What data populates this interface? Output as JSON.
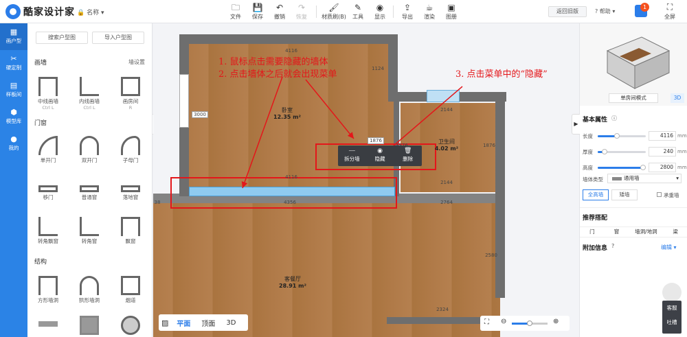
{
  "app": {
    "logo_text": "酷家设计家",
    "project_name": "名称"
  },
  "toolbar": {
    "items": [
      {
        "label": "文件",
        "icon": "file-icon"
      },
      {
        "label": "保存",
        "icon": "save-icon"
      },
      {
        "label": "撤销",
        "icon": "undo-icon"
      },
      {
        "label": "恢复",
        "icon": "redo-icon"
      },
      {
        "label": "材质刷(B)",
        "icon": "brush-icon"
      },
      {
        "label": "工具",
        "icon": "tool-icon"
      },
      {
        "label": "显示",
        "icon": "eye-icon"
      },
      {
        "label": "导出",
        "icon": "export-icon"
      },
      {
        "label": "渲染",
        "icon": "render-icon"
      },
      {
        "label": "图册",
        "icon": "album-icon"
      }
    ],
    "back_old": "返回旧版",
    "help": "帮助",
    "badge": "1",
    "fullscreen": "全屏"
  },
  "leftnav": [
    {
      "label": "画户型"
    },
    {
      "label": "硬定制"
    },
    {
      "label": "样板间"
    },
    {
      "label": "模型库"
    },
    {
      "label": "我的"
    }
  ],
  "panel": {
    "search_btn": "搜索户型图",
    "import_btn": "导入户型图",
    "wall_section": "画墙",
    "wall_settings": "墙设置",
    "walls": [
      {
        "label": "中线画墙",
        "sub": "Ctrl L"
      },
      {
        "label": "内线画墙",
        "sub": "Ctrl L"
      },
      {
        "label": "画房间",
        "sub": "R"
      }
    ],
    "door_section": "门窗",
    "doors": [
      {
        "label": "单开门"
      },
      {
        "label": "双开门"
      },
      {
        "label": "子母门"
      },
      {
        "label": "移门"
      },
      {
        "label": "普通窗"
      },
      {
        "label": "落地窗"
      },
      {
        "label": "转角飘窗"
      },
      {
        "label": "转角窗"
      },
      {
        "label": "飘窗"
      }
    ],
    "struct_section": "结构",
    "structs": [
      {
        "label": "方形墙洞"
      },
      {
        "label": "拱形墙洞"
      },
      {
        "label": "烟道"
      }
    ]
  },
  "canvas": {
    "rooms": [
      {
        "name": "卧室",
        "area": "12.35 m²"
      },
      {
        "name": "卫生间",
        "area": "4.02 m²"
      },
      {
        "name": "客餐厅",
        "area": "28.91 m²"
      }
    ],
    "dims": [
      "4116",
      "1124",
      "3000",
      "2144",
      "1876",
      "1876",
      "1876",
      "4116",
      "4356",
      "2144",
      "2764",
      "2580",
      "2324",
      "38"
    ],
    "notes": [
      "1. 鼠标点击需要隐藏的墙体",
      "2. 点击墙体之后就会出现菜单",
      "3. 点击菜单中的“隐藏”"
    ],
    "context_menu": [
      {
        "label": "拆分墙",
        "icon": "split-icon"
      },
      {
        "label": "隐藏",
        "icon": "eye-icon"
      },
      {
        "label": "删除",
        "icon": "trash-icon"
      }
    ],
    "views": [
      "平面",
      "顶面",
      "3D"
    ]
  },
  "right": {
    "mode_btn": "单房间模式",
    "mode_3d": "3D",
    "basic_props": "基本属性",
    "props": [
      {
        "label": "长度",
        "value": "4116",
        "unit": "mm",
        "fraction": 0.4
      },
      {
        "label": "厚度",
        "value": "240",
        "unit": "mm",
        "fraction": 0.15
      },
      {
        "label": "高度",
        "value": "2800",
        "unit": "mm",
        "fraction": 0.95
      }
    ],
    "wall_type_label": "墙体类型",
    "wall_type_value": "通用墙",
    "tabs": [
      "全高墙",
      "矮墙"
    ],
    "bearing": "承重墙",
    "recommend": "推荐搭配",
    "rec_items": [
      "门",
      "窗",
      "墙洞/地洞",
      "梁"
    ],
    "extra": "附加信息",
    "edit": "编辑",
    "service": "客服",
    "feedback": "吐槽"
  },
  "colors": {
    "brand": "#2b83e6",
    "note_red": "#e4161a",
    "menu_bg": "#3a3d42"
  }
}
